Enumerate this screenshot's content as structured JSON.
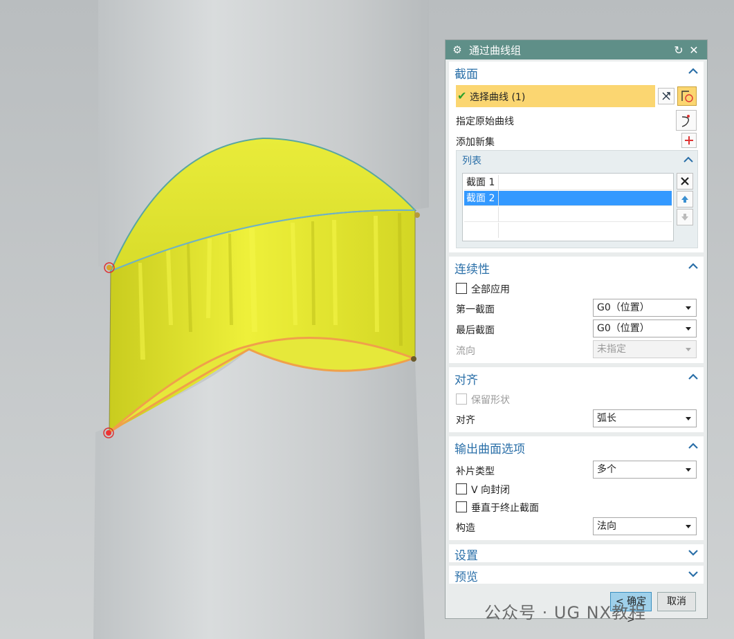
{
  "dialog": {
    "title": "通过曲线组",
    "section": {
      "title": "截面",
      "select_curve": "选择曲线 (1)",
      "specify_origin": "指定原始曲线",
      "add_new_set": "添加新集",
      "list": {
        "title": "列表",
        "items": [
          "截面 1",
          "截面 2"
        ],
        "selected_index": 1
      }
    },
    "continuity": {
      "title": "连续性",
      "apply_all": "全部应用",
      "first_label": "第一截面",
      "first_value": "G0（位置）",
      "last_label": "最后截面",
      "last_value": "G0（位置）",
      "flow_label": "流向",
      "flow_value": "未指定"
    },
    "alignment": {
      "title": "对齐",
      "preserve_shape": "保留形状",
      "align_label": "对齐",
      "align_value": "弧长"
    },
    "output": {
      "title": "输出曲面选项",
      "patch_label": "补片类型",
      "patch_value": "多个",
      "v_closed": "V 向封闭",
      "normal_end": "垂直于终止截面",
      "construct_label": "构造",
      "construct_value": "法向"
    },
    "settings": {
      "title": "设置"
    },
    "preview": {
      "title": "预览"
    },
    "buttons": {
      "ok": "< 确定 >",
      "cancel": "取消"
    }
  },
  "watermark": "公众号 · UG  NX教程",
  "colors": {
    "title_bar": "#5f8f88",
    "section_header": "#2a6fa8",
    "surface_yellow": "#e3e63a",
    "selection_highlight": "#fbd671",
    "list_selected": "#3399ff",
    "curve_orange": "#f0a04a"
  }
}
